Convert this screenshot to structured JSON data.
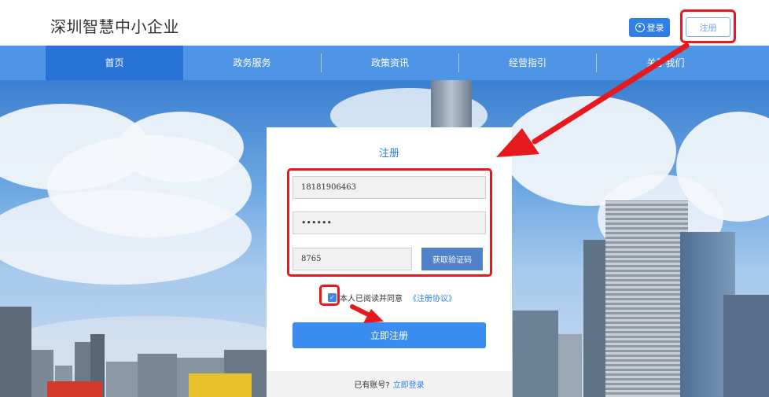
{
  "header": {
    "logo": "深圳智慧中小企业",
    "login_label": "登录",
    "register_label": "注册"
  },
  "nav": {
    "items": [
      {
        "label": "首页"
      },
      {
        "label": "政务服务"
      },
      {
        "label": "政策资讯"
      },
      {
        "label": "经营指引"
      },
      {
        "label": "关于我们"
      }
    ]
  },
  "register_form": {
    "title": "注册",
    "phone_value": "18181906463",
    "password_value": "••••••",
    "code_value": "8765",
    "get_code_label": "获取验证码",
    "agree_text": "本人已阅读并同意",
    "agreement_link": "《注册协议》",
    "agree_checked": true,
    "submit_label": "立即注册",
    "footer_text": "已有账号?",
    "footer_link": "立即登录"
  },
  "colors": {
    "accent": "#2f7fe5",
    "nav": "#4f95e6",
    "nav_active": "#2a73d6",
    "highlight": "#e6191f"
  }
}
